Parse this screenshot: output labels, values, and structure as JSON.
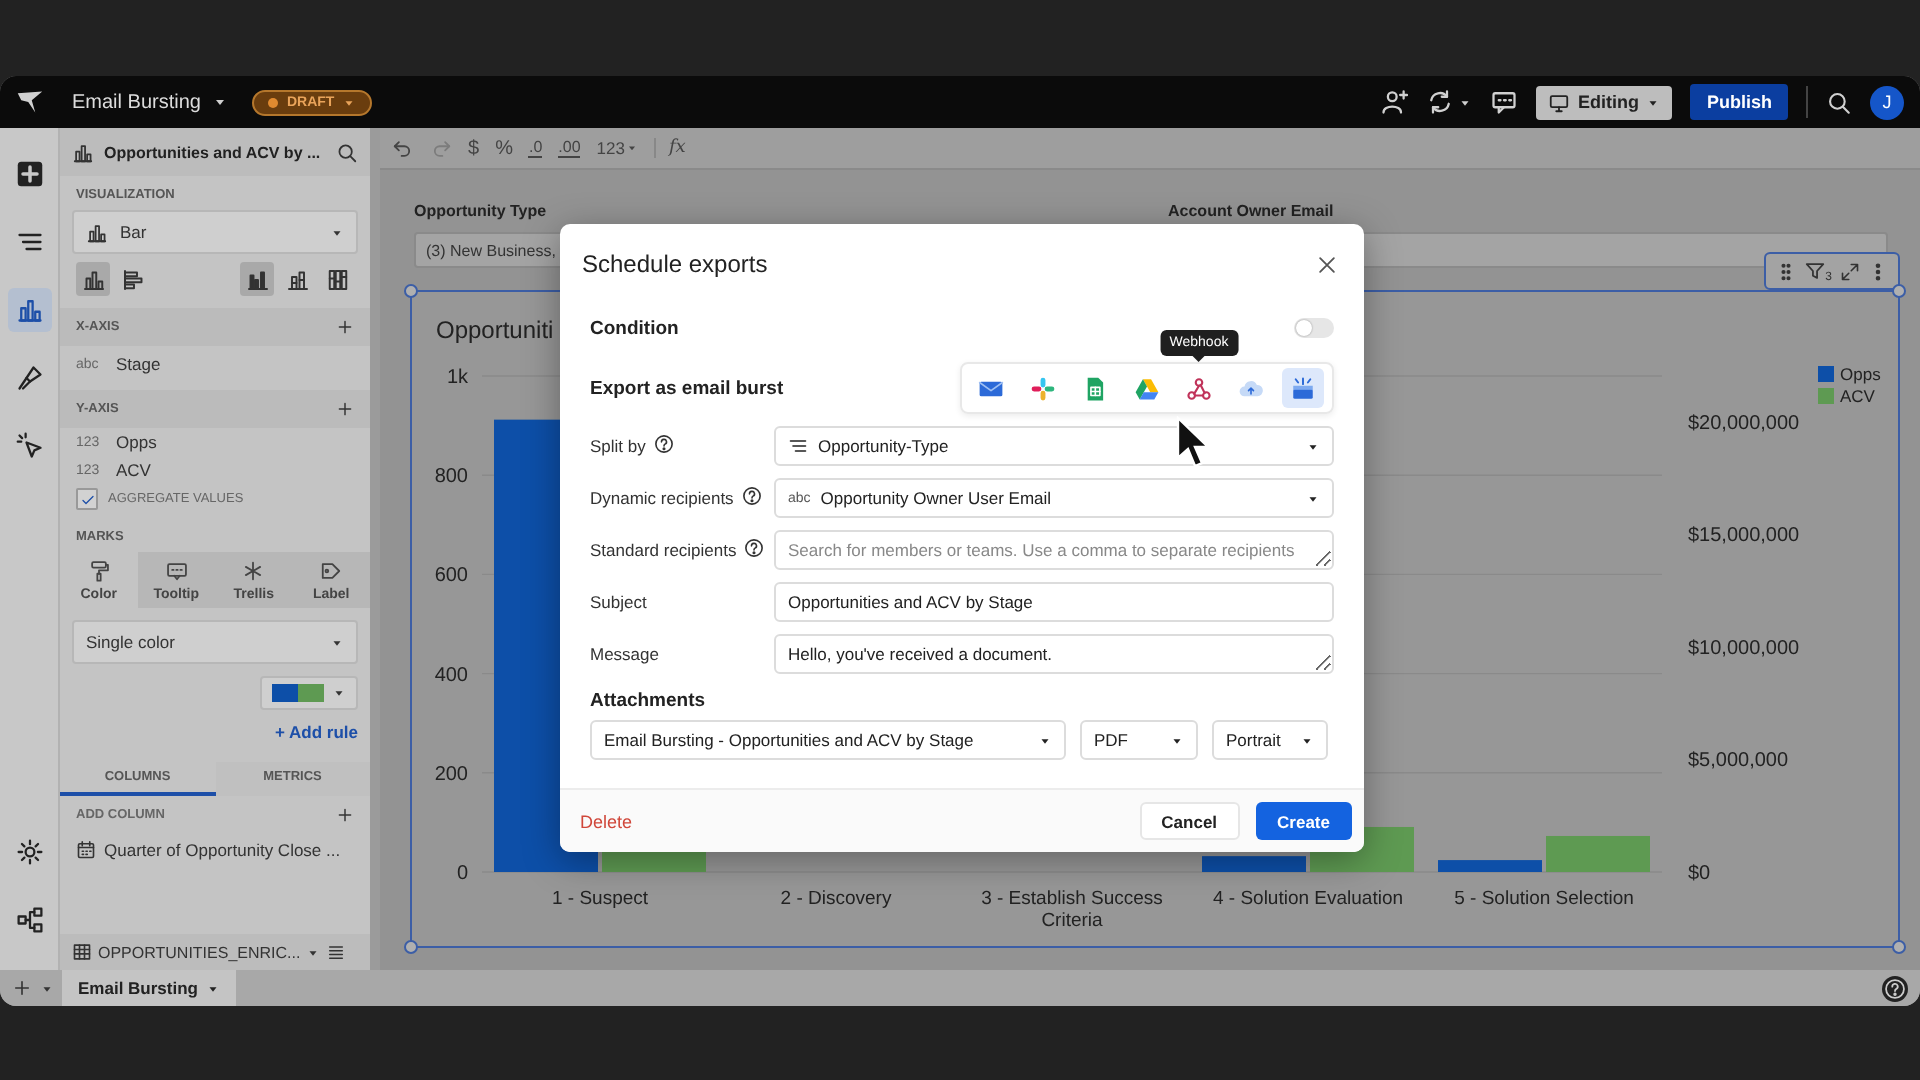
{
  "top_bar": {
    "title": "Email Bursting",
    "status": "DRAFT",
    "mode_button": "Editing",
    "publish_button": "Publish",
    "avatar": "J"
  },
  "rail": {
    "top": [
      {
        "kind": "add",
        "selected": false
      },
      {
        "kind": "outline",
        "selected": false
      },
      {
        "kind": "chart",
        "selected": true
      },
      {
        "kind": "format",
        "selected": false
      },
      {
        "kind": "actions",
        "selected": false
      }
    ],
    "bottom": [
      {
        "kind": "settings",
        "selected": false
      },
      {
        "kind": "lineage",
        "selected": false
      }
    ]
  },
  "panel": {
    "title": "Opportunities and ACV by ...",
    "visualization": {
      "label": "VISUALIZATION",
      "type": "Bar",
      "layouts": [
        {
          "kind": "vertical",
          "selected": true
        },
        {
          "kind": "horizontal",
          "selected": false
        }
      ],
      "styles": [
        {
          "kind": "grouped",
          "selected": true
        },
        {
          "kind": "stacked",
          "selected": false
        },
        {
          "kind": "full",
          "selected": false
        }
      ]
    },
    "x_axis": {
      "label": "X-AXIS",
      "fields": [
        {
          "type": "abc",
          "name": "Stage"
        }
      ]
    },
    "y_axis": {
      "label": "Y-AXIS",
      "fields": [
        {
          "type": "123",
          "name": "Opps"
        },
        {
          "type": "123",
          "name": "ACV"
        }
      ],
      "aggregate": {
        "label": "AGGREGATE VALUES",
        "checked": true
      }
    },
    "marks": {
      "label": "MARKS",
      "tabs": [
        {
          "kind": "color",
          "label": "Color",
          "selected": true
        },
        {
          "kind": "tooltip",
          "label": "Tooltip",
          "selected": false
        },
        {
          "kind": "trellis",
          "label": "Trellis",
          "selected": false
        },
        {
          "kind": "label",
          "label": "Label",
          "selected": false
        }
      ],
      "color_mode": "Single color",
      "add_rule": "+ Add rule"
    },
    "field_tabs": [
      {
        "label": "COLUMNS",
        "selected": true
      },
      {
        "label": "METRICS",
        "selected": false
      }
    ],
    "add_column": "ADD COLUMN",
    "columns": [
      {
        "name": "Quarter of Opportunity Close ..."
      }
    ],
    "source": "OPPORTUNITIES_ENRIC..."
  },
  "toolbar": [
    {
      "kind": "undo",
      "disabled": false
    },
    {
      "kind": "redo",
      "disabled": true
    },
    {
      "kind": "text",
      "label": "$"
    },
    {
      "kind": "text",
      "label": "%"
    },
    {
      "kind": "decimals",
      "label": ".0"
    },
    {
      "kind": "decimals",
      "label": ".00"
    },
    {
      "kind": "dropdown",
      "label": "123"
    },
    {
      "kind": "formula",
      "label": "fx"
    }
  ],
  "filters": [
    {
      "label": "Opportunity Type",
      "value": "(3) New Business,"
    },
    {
      "label": "Account Owner Email"
    }
  ],
  "chart": {
    "title": "Opportuniti",
    "filter_count": "3",
    "chart_data": {
      "type": "bar",
      "categories": [
        "1 - Suspect",
        "2 - Discovery",
        "3 - Establish Success Criteria",
        "4 - Solution Evaluation",
        "5 - Solution Selection"
      ],
      "series": [
        {
          "name": "Opps",
          "color": "#0d4fa8",
          "values": [
            912,
            null,
            null,
            32,
            24
          ]
        },
        {
          "name": "ACV",
          "color": "#5e9a52",
          "axis": "y2",
          "values": [
            1000000,
            null,
            null,
            2000000,
            1600000
          ]
        }
      ],
      "stacked": false,
      "grid": true,
      "legend": true,
      "ylim": [
        0,
        1000
      ],
      "yticks": [
        0,
        200,
        400,
        600,
        800,
        {
          "value": 1000,
          "label": "1k"
        }
      ],
      "y2lim": [
        0,
        22040000
      ],
      "y2ticks": [
        {
          "value": 0,
          "label": "$0"
        },
        {
          "value": 5000000,
          "label": "$5,000,000"
        },
        {
          "value": 10000000,
          "label": "$10,000,000"
        },
        {
          "value": 15000000,
          "label": "$15,000,000"
        },
        {
          "value": 20000000,
          "label": "$20,000,000"
        }
      ]
    }
  },
  "modal": {
    "title": "Schedule exports",
    "condition": {
      "label": "Condition",
      "on": false
    },
    "export": {
      "label": "Export as email burst",
      "destinations": [
        {
          "kind": "email",
          "selected": false
        },
        {
          "kind": "slack",
          "selected": false
        },
        {
          "kind": "sheets",
          "selected": false
        },
        {
          "kind": "drive",
          "selected": false
        },
        {
          "kind": "webhook",
          "selected": false,
          "tooltip": "Webhook"
        },
        {
          "kind": "storage",
          "selected": false
        },
        {
          "kind": "burst",
          "selected": true
        }
      ]
    },
    "fields": [
      {
        "kind": "select",
        "label": "Split by",
        "help": true,
        "value": "Opportunity-Type"
      },
      {
        "kind": "select",
        "label": "Dynamic recipients",
        "help": true,
        "type": "abc",
        "value": "Opportunity Owner User Email"
      },
      {
        "kind": "textarea",
        "label": "Standard recipients",
        "help": true,
        "placeholder": "Search for members or teams. Use a comma to separate recipients"
      },
      {
        "kind": "input",
        "label": "Subject",
        "help": false,
        "value": "Opportunities and ACV by Stage"
      },
      {
        "kind": "textarea",
        "label": "Message",
        "help": false,
        "value": "Hello, you've received a document."
      }
    ],
    "attachments": {
      "label": "Attachments",
      "selects": [
        "Email Bursting - Opportunities and ACV by Stage",
        "PDF",
        "Portrait"
      ]
    },
    "delete": "Delete",
    "cancel": "Cancel",
    "create": "Create"
  },
  "sheet_tabs": [
    {
      "label": "Email Bursting",
      "selected": true
    }
  ]
}
